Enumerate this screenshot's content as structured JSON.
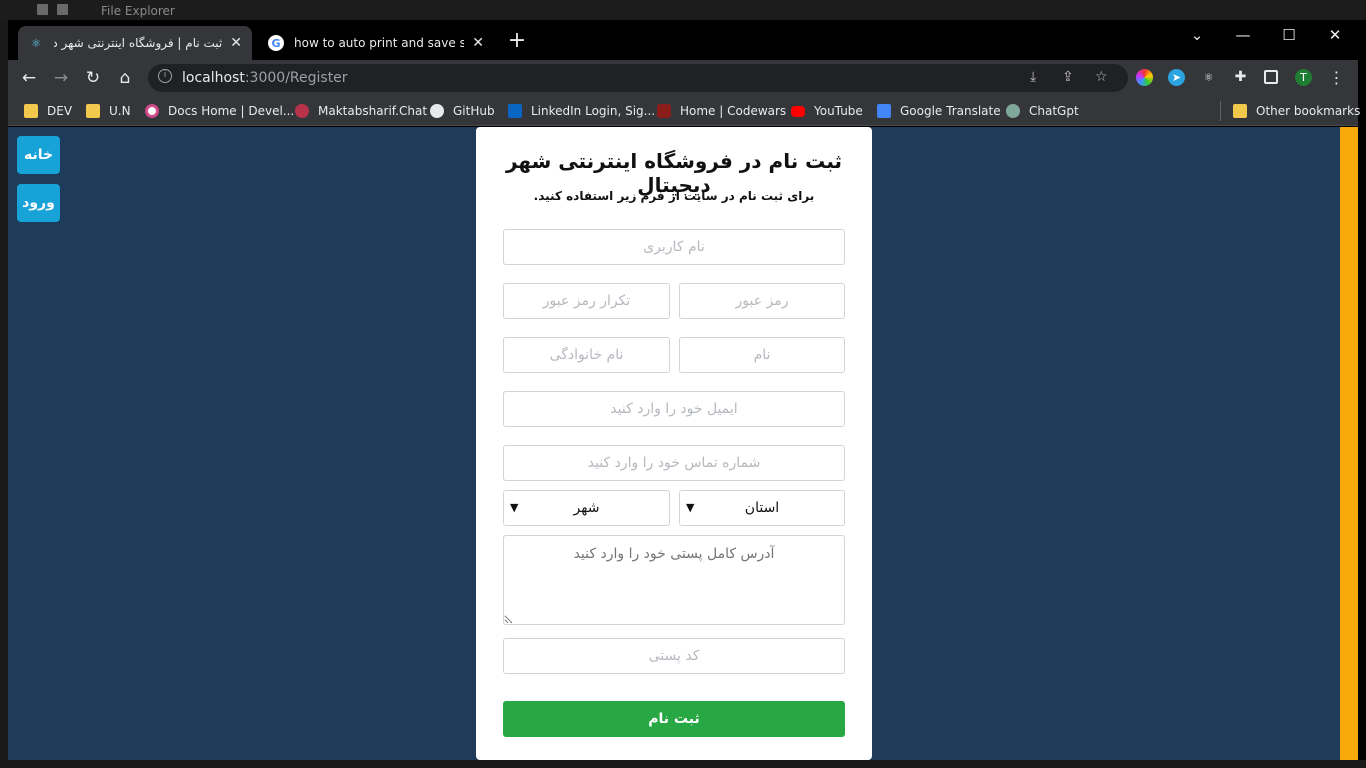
{
  "file_explorer": {
    "title": "File Explorer"
  },
  "browser": {
    "tabs": [
      {
        "title": "ثبت نام | فروشگاه اینترنتی شهر دیجیتال",
        "active": true
      },
      {
        "title": "how to auto print and save screen",
        "active": false
      }
    ],
    "new_tab_symbol": "+",
    "url_host": "localhost",
    "url_rest": ":3000/Register",
    "profile_initial": "T",
    "bookmarks": [
      {
        "label": "DEV",
        "icon": "folder-icon"
      },
      {
        "label": "U.N",
        "icon": "folder-icon"
      },
      {
        "label": "Docs Home | Devel...",
        "icon": "docs-icon"
      },
      {
        "label": "Maktabsharif.Chat",
        "icon": "chat-icon"
      },
      {
        "label": "GitHub",
        "icon": "github-icon"
      },
      {
        "label": "LinkedIn Login, Sig...",
        "icon": "linkedin-icon"
      },
      {
        "label": "Home | Codewars",
        "icon": "codewars-icon"
      },
      {
        "label": "YouTube",
        "icon": "youtube-icon"
      },
      {
        "label": "Google Translate",
        "icon": "translate-icon"
      },
      {
        "label": "ChatGpt",
        "icon": "chatgpt-icon"
      }
    ],
    "other_bookmarks": "Other bookmarks"
  },
  "sidebar": {
    "home_label": "خانه",
    "login_label": "ورود"
  },
  "form": {
    "title": "ثبت نام در فروشگاه اینترنتی شهر دیجیتال",
    "subtitle": "برای ثبت نام در سایت از فرم زیر استفاده کنید.",
    "username_placeholder": "نام کاربری",
    "password_placeholder": "رمز عبور",
    "password_repeat_placeholder": "تکرار رمز عبور",
    "first_name_placeholder": "نام",
    "last_name_placeholder": "نام خانوادگی",
    "email_placeholder": "ایمیل خود را وارد کنید",
    "phone_placeholder": "شماره تماس خود را وارد کنید",
    "province_value": "استان",
    "city_value": "شهر",
    "address_placeholder": "آدرس کامل پستی خود را وارد کنید",
    "postal_code_placeholder": "کد پستی",
    "submit_label": "ثبت نام"
  },
  "colors": {
    "page_bg": "#1f3b5a",
    "side_button": "#17a2d8",
    "submit": "#28a745",
    "right_accent": "#f7a80b"
  }
}
